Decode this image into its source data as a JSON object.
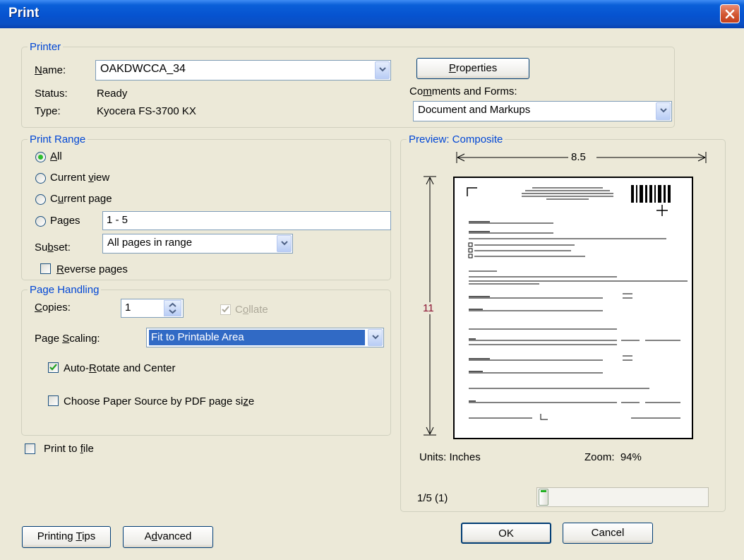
{
  "window": {
    "title": "Print"
  },
  "printer": {
    "legend": "Printer",
    "name_label": "Name:",
    "name_value": "OAKDWCCA_34",
    "status_label": "Status:",
    "status_value": "Ready",
    "type_label": "Type:",
    "type_value": "Kyocera FS-3700 KX",
    "properties_button": "Properties",
    "comments_label": "Comments and Forms:",
    "comments_value": "Document and Markups"
  },
  "print_range": {
    "legend": "Print Range",
    "all": "All",
    "current_view": "Current view",
    "current_page": "Current page",
    "pages": "Pages",
    "pages_value": "1 - 5",
    "subset_label": "Subset:",
    "subset_value": "All pages in range",
    "reverse_pages": "Reverse pages",
    "selected": "all"
  },
  "page_handling": {
    "legend": "Page Handling",
    "copies_label": "Copies:",
    "copies_value": "1",
    "collate": "Collate",
    "scaling_label": "Page Scaling:",
    "scaling_value": "Fit to Printable Area",
    "auto_rotate": "Auto-Rotate and Center",
    "auto_rotate_checked": true,
    "paper_source": "Choose Paper Source by PDF page size",
    "paper_source_checked": false
  },
  "print_to_file": {
    "label": "Print to file",
    "checked": false
  },
  "preview": {
    "legend": "Preview: Composite",
    "width_label": "8.5",
    "height_label": "11",
    "units": "Units: Inches",
    "zoom": "Zoom:  94%",
    "page_indicator": "1/5 (1)",
    "slider_position": 0.0
  },
  "buttons": {
    "printing_tips": "Printing Tips",
    "advanced": "Advanced",
    "ok": "OK",
    "cancel": "Cancel"
  },
  "colors": {
    "title_bar": "#0653d0",
    "group_label": "#0046d5",
    "selection": "#316ac5",
    "dialog_bg": "#ece9d8"
  }
}
